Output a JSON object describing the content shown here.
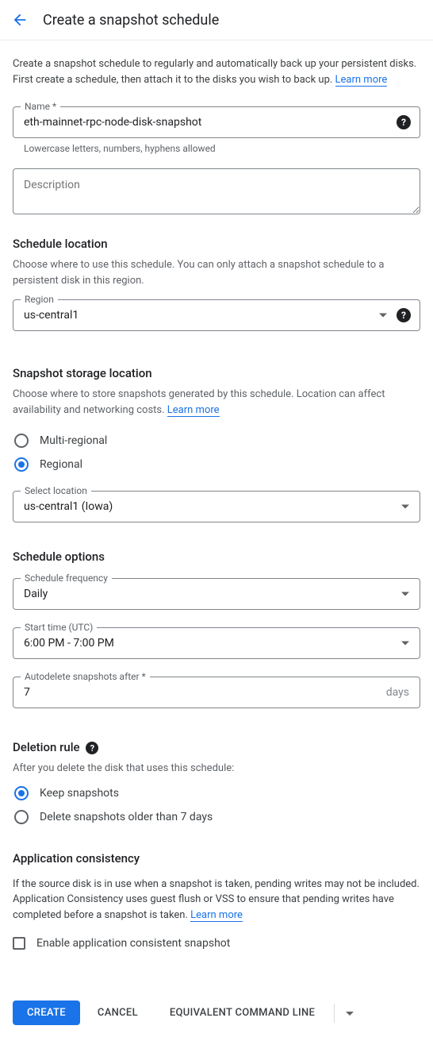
{
  "header": {
    "title": "Create a snapshot schedule"
  },
  "intro": {
    "text": "Create a snapshot schedule to regularly and automatically back up your persistent disks. First create a schedule, then attach it to the disks you wish to back up. ",
    "link": "Learn more"
  },
  "name": {
    "label": "Name *",
    "value": "eth-mainnet-rpc-node-disk-snapshot",
    "hint": "Lowercase letters, numbers, hyphens allowed"
  },
  "description": {
    "placeholder": "Description",
    "value": ""
  },
  "scheduleLocation": {
    "title": "Schedule location",
    "desc": "Choose where to use this schedule. You can only attach a snapshot schedule to a persistent disk in this region.",
    "regionLabel": "Region",
    "regionValue": "us-central1"
  },
  "storage": {
    "title": "Snapshot storage location",
    "desc": "Choose where to store snapshots generated by this schedule. Location can affect availability and networking costs. ",
    "link": "Learn more",
    "multiRegional": "Multi-regional",
    "regional": "Regional",
    "selectLabel": "Select location",
    "selectValue": "us-central1 (Iowa)"
  },
  "scheduleOptions": {
    "title": "Schedule options",
    "freqLabel": "Schedule frequency",
    "freqValue": "Daily",
    "startLabel": "Start time (UTC)",
    "startValue": "6:00 PM - 7:00 PM",
    "autoLabel": "Autodelete snapshots after *",
    "autoValue": "7",
    "autoUnit": "days"
  },
  "deletion": {
    "title": "Deletion rule",
    "desc": "After you delete the disk that uses this schedule:",
    "keep": "Keep snapshots",
    "deleteOlder": "Delete snapshots older than 7 days"
  },
  "appConsistency": {
    "title": "Application consistency",
    "desc": "If the source disk is in use when a snapshot is taken, pending writes may not be included. Application Consistency uses guest flush or VSS to ensure that pending writes have completed before a snapshot is taken. ",
    "link": "Learn more",
    "checkbox": "Enable application consistent snapshot"
  },
  "footer": {
    "create": "CREATE",
    "cancel": "CANCEL",
    "cmdline": "EQUIVALENT COMMAND LINE"
  }
}
